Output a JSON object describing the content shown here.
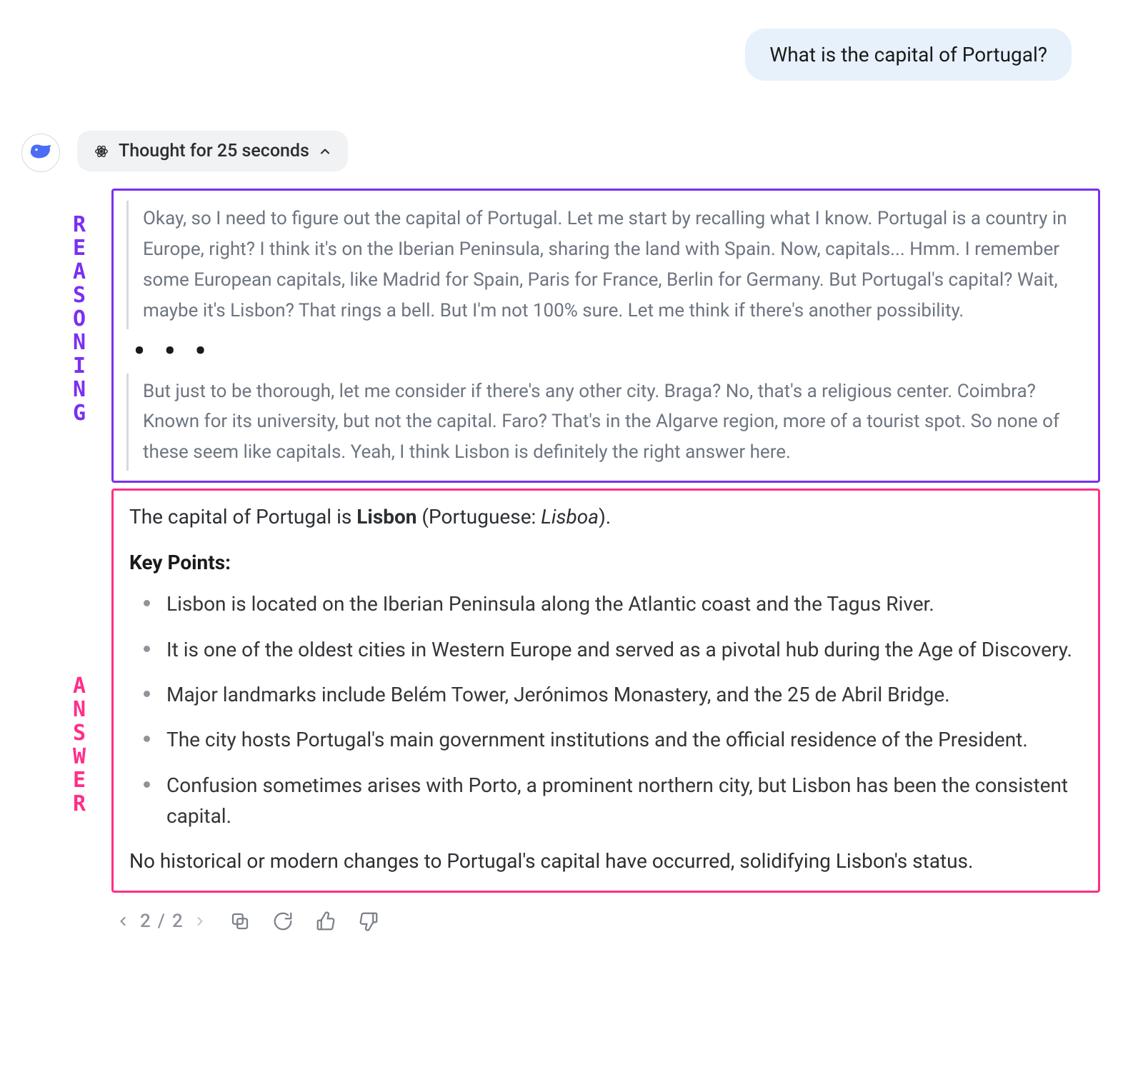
{
  "user": {
    "message": "What is the capital of Portugal?"
  },
  "assistant": {
    "thought_label": "Thought for 25 seconds",
    "labels": {
      "reasoning": "REASONING",
      "answer": "ANSWER"
    },
    "reasoning": {
      "para1": "Okay, so I need to figure out the capital of Portugal. Let me start by recalling what I know. Portugal is a country in Europe, right? I think it's on the Iberian Peninsula, sharing the land with Spain. Now, capitals... Hmm. I remember some European capitals, like Madrid for Spain, Paris for France, Berlin for Germany. But Portugal's capital? Wait, maybe it's Lisbon? That rings a bell. But I'm not 100% sure. Let me think if there's another possibility.",
      "ellipsis": "• • •",
      "para2": "But just to be thorough, let me consider if there's any other city. Braga? No, that's a religious center. Coimbra? Known for its university, but not the capital. Faro? That's in the Algarve region, more of a tourist spot. So none of these seem like capitals. Yeah, I think Lisbon is definitely the right answer here."
    },
    "answer": {
      "lead_pre": "The capital of Portugal is ",
      "lead_bold": "Lisbon",
      "lead_mid": " (Portuguese: ",
      "lead_italic": "Lisboa",
      "lead_post": ").",
      "key_points_heading": "Key Points:",
      "key_points": [
        "Lisbon is located on the Iberian Peninsula along the Atlantic coast and the Tagus River.",
        "It is one of the oldest cities in Western Europe and served as a pivotal hub during the Age of Discovery.",
        "Major landmarks include Belém Tower, Jerónimos Monastery, and the 25 de Abril Bridge.",
        "The city hosts Portugal's main government institutions and the official residence of the President.",
        "Confusion sometimes arises with Porto, a prominent northern city, but Lisbon has been the consistent capital."
      ],
      "closing": "No historical or modern changes to Portugal's capital have occurred, solidifying Lisbon's status."
    }
  },
  "actions": {
    "page_current": "2",
    "page_sep": "/",
    "page_total": "2"
  }
}
